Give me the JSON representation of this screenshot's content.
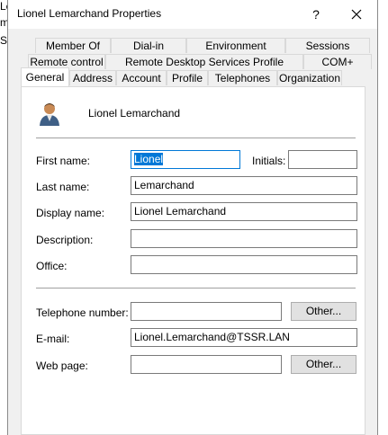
{
  "background_fragments": [
    "Le",
    "m",
    "Se"
  ],
  "dialog": {
    "title": "Lionel Lemarchand Properties",
    "help_glyph": "?",
    "close_glyph": "✕"
  },
  "tabs": {
    "row1": [
      "Member Of",
      "Dial-in",
      "Environment",
      "Sessions"
    ],
    "row2": [
      "Remote control",
      "Remote Desktop Services Profile",
      "COM+"
    ],
    "row3": [
      "General",
      "Address",
      "Account",
      "Profile",
      "Telephones",
      "Organization"
    ],
    "active": "General"
  },
  "general": {
    "display_heading": "Lionel Lemarchand",
    "avatar_icon": "user-icon",
    "labels": {
      "first_name": "First name:",
      "initials": "Initials:",
      "last_name": "Last name:",
      "display_name": "Display name:",
      "description": "Description:",
      "office": "Office:",
      "telephone": "Telephone number:",
      "email": "E-mail:",
      "web_page": "Web page:"
    },
    "values": {
      "first_name": "Lionel",
      "initials": "",
      "last_name": "Lemarchand",
      "display_name": "Lionel Lemarchand",
      "description": "",
      "office": "",
      "telephone": "",
      "email": "Lionel.Lemarchand@TSSR.LAN",
      "web_page": ""
    },
    "other_button": "Other..."
  },
  "colors": {
    "selection": "#0078d7",
    "window_bg": "#f0f0f0",
    "panel_bg": "#ffffff"
  }
}
